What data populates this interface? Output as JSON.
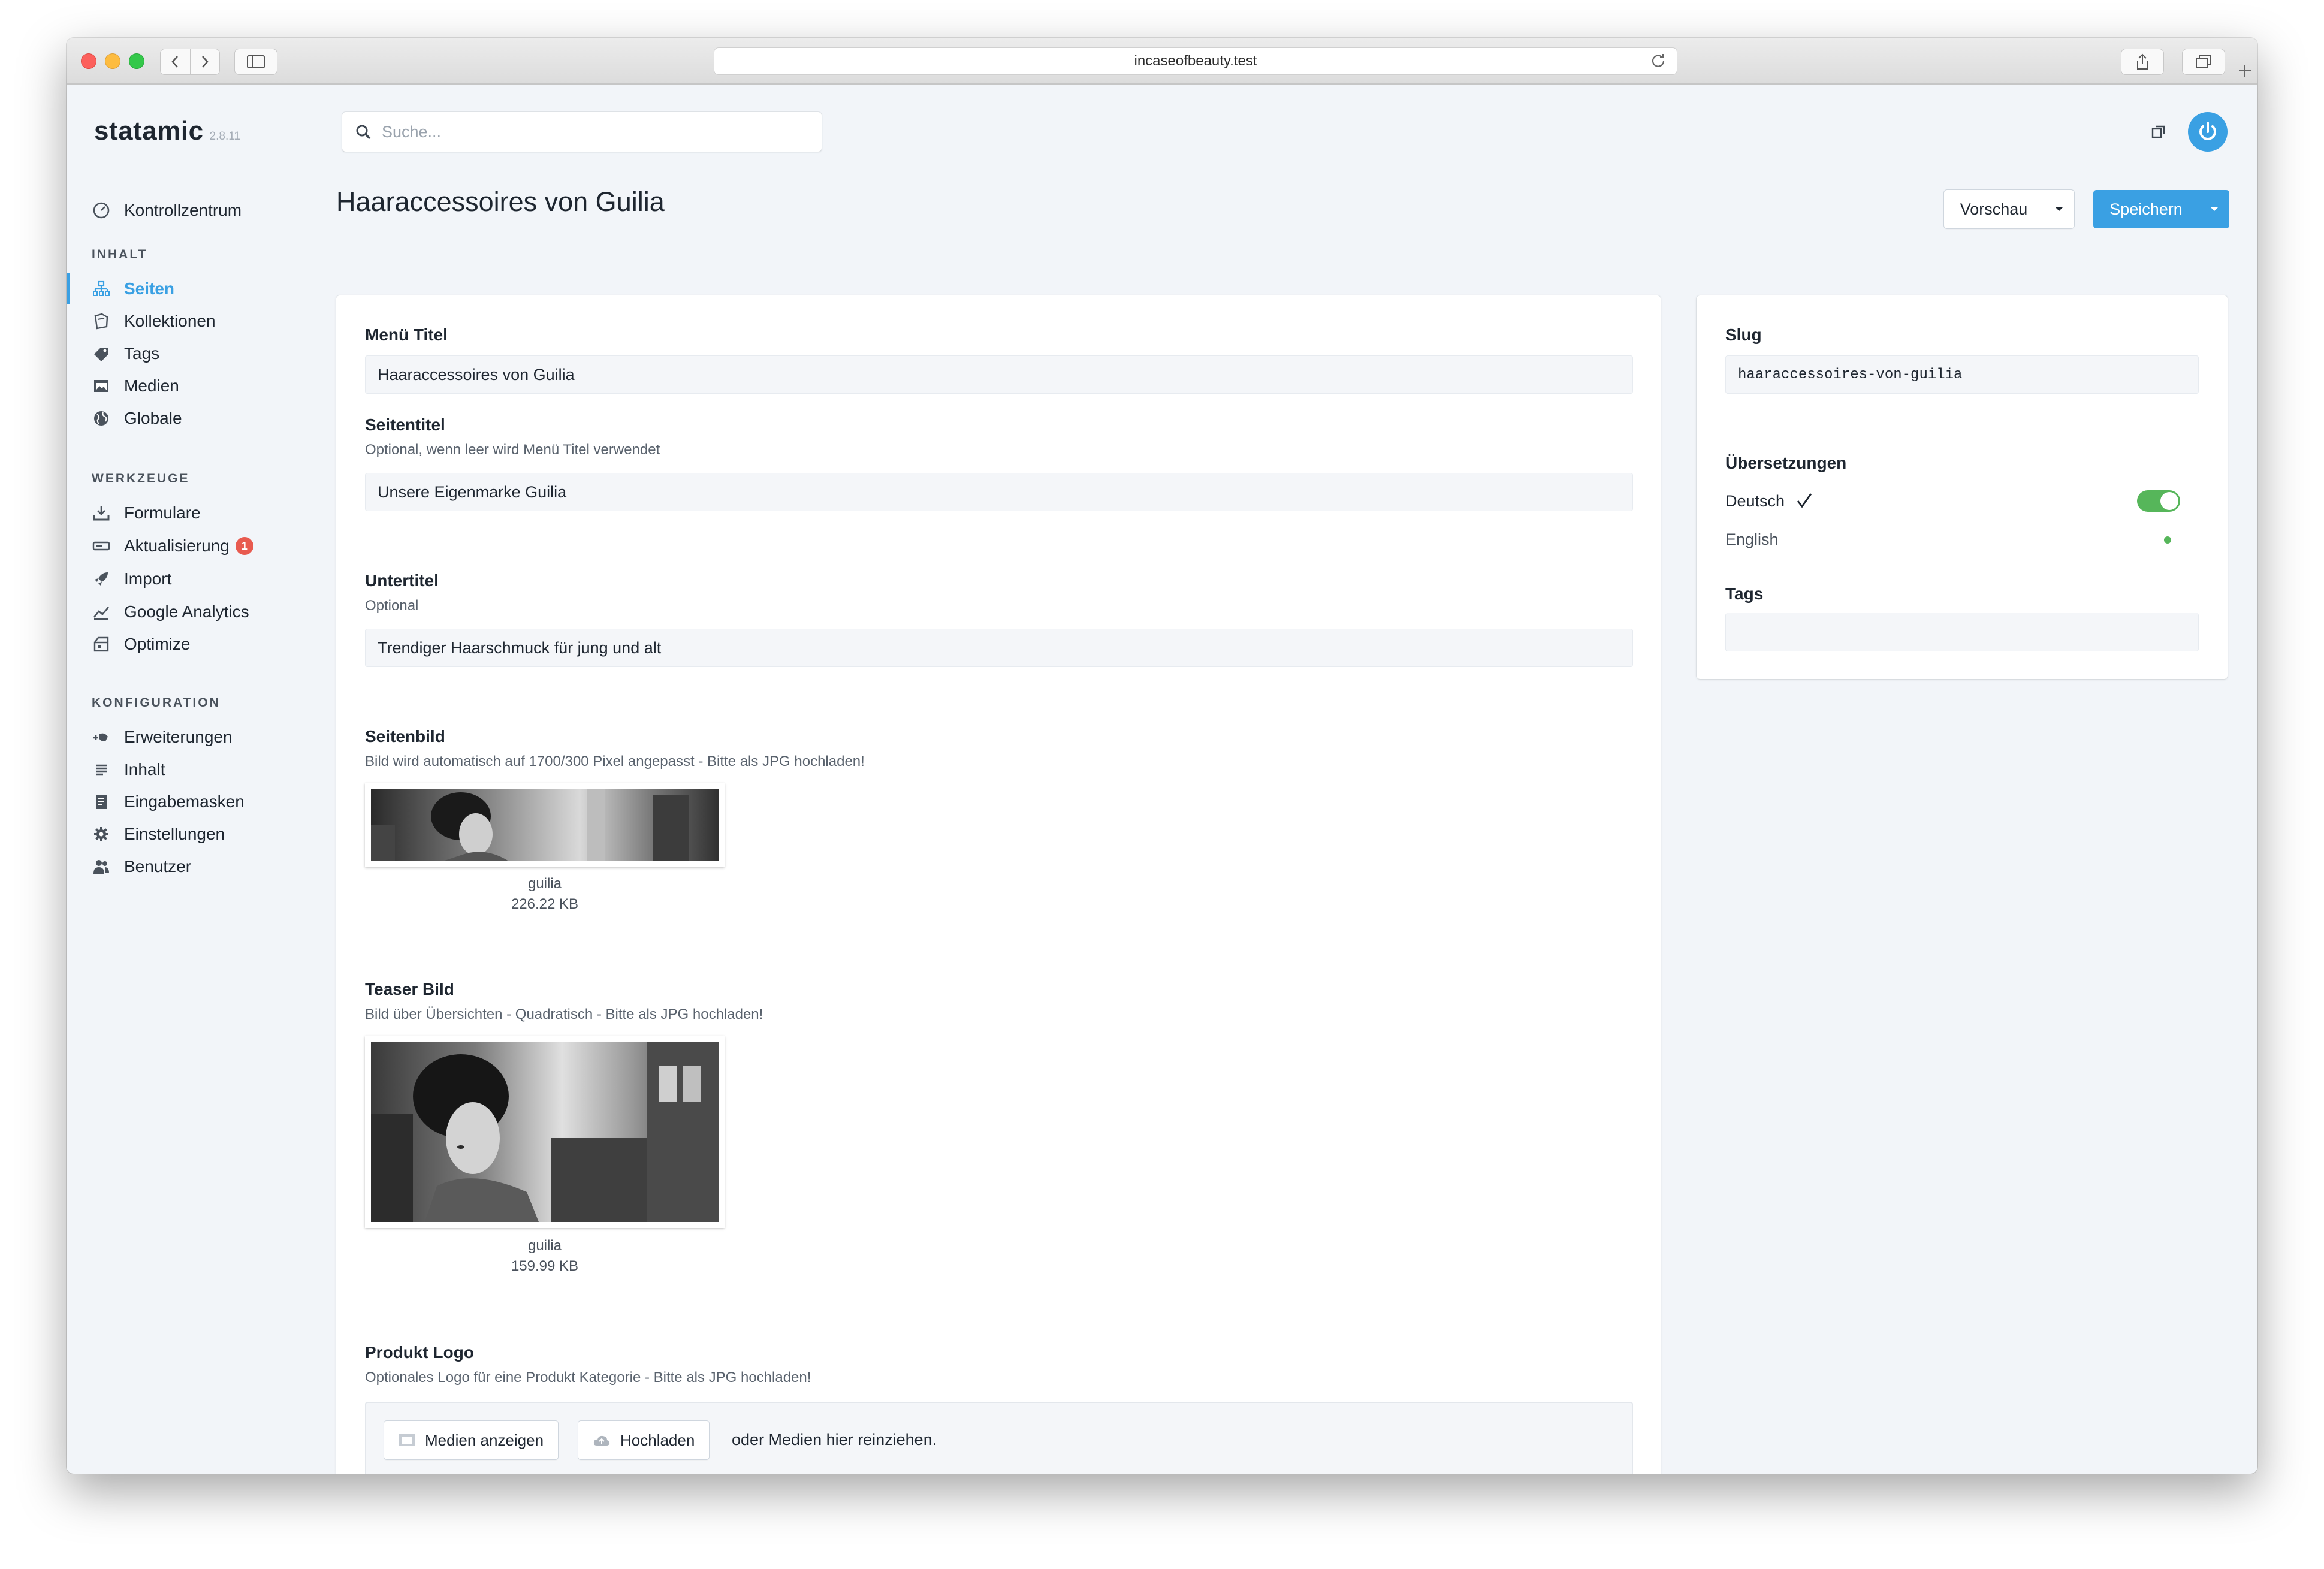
{
  "browser": {
    "url": "incaseofbeauty.test"
  },
  "app": {
    "name": "statamic",
    "version": "2.8.11"
  },
  "search": {
    "placeholder": "Suche..."
  },
  "nav": {
    "dashboard": "Kontrollzentrum",
    "sections": [
      {
        "heading": "INHALT",
        "items": [
          "Seiten",
          "Kollektionen",
          "Tags",
          "Medien",
          "Globale"
        ]
      },
      {
        "heading": "WERKZEUGE",
        "items": [
          "Formulare",
          "Aktualisierung",
          "Import",
          "Google Analytics",
          "Optimize"
        ]
      },
      {
        "heading": "KONFIGURATION",
        "items": [
          "Erweiterungen",
          "Inhalt",
          "Eingabemasken",
          "Einstellungen",
          "Benutzer"
        ]
      }
    ],
    "active_item": "Seiten",
    "update_badge": "1"
  },
  "page": {
    "title": "Haaraccessoires von Guilia",
    "preview_label": "Vorschau",
    "save_label": "Speichern"
  },
  "form": {
    "menu_title": {
      "label": "Menü Titel",
      "value": "Haaraccessoires von Guilia"
    },
    "page_title": {
      "label": "Seitentitel",
      "help": "Optional, wenn leer wird Menü Titel verwendet",
      "value": "Unsere Eigenmarke Guilia"
    },
    "subtitle": {
      "label": "Untertitel",
      "help": "Optional",
      "value": "Trendiger Haarschmuck für jung und alt"
    },
    "page_image": {
      "label": "Seitenbild",
      "help": "Bild wird automatisch auf 1700/300 Pixel angepasst - Bitte als JPG hochladen!",
      "filename": "guilia",
      "size": "226.22 KB"
    },
    "teaser_image": {
      "label": "Teaser Bild",
      "help": "Bild über Übersichten - Quadratisch - Bitte als JPG hochladen!",
      "filename": "guilia",
      "size": "159.99 KB"
    },
    "product_logo": {
      "label": "Produkt Logo",
      "help": "Optionales Logo für eine Produkt Kategorie - Bitte als JPG hochladen!",
      "browse_label": "Medien anzeigen",
      "upload_label": "Hochladen",
      "drop_text": "oder Medien hier reinziehen."
    }
  },
  "sidebar": {
    "slug": {
      "label": "Slug",
      "value": "haaraccessoires-von-guilia"
    },
    "translations": {
      "label": "Übersetzungen",
      "items": [
        {
          "name": "Deutsch",
          "enabled": true
        },
        {
          "name": "English",
          "enabled": true
        }
      ]
    },
    "tags": {
      "label": "Tags",
      "value": ""
    }
  },
  "colors": {
    "accent": "#3aa0e3",
    "badge": "#e85a4f",
    "toggle_on": "#56b65a"
  }
}
